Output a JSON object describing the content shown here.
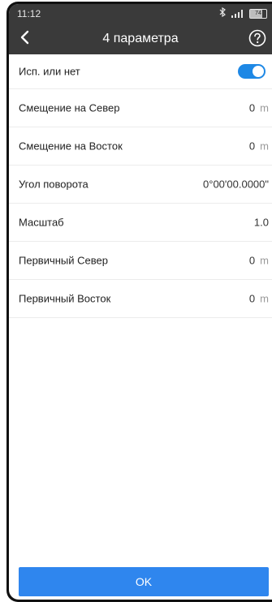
{
  "status_bar": {
    "time": "11:12",
    "battery_percent": "74",
    "battery_level": 0.74,
    "icons": [
      "bluetooth-icon",
      "signal-icon",
      "battery-icon"
    ]
  },
  "header": {
    "title": "4 параметра",
    "back_icon": "chevron-left-icon",
    "help_icon": "question-circle-icon"
  },
  "rows": [
    {
      "label": "Исп. или нет",
      "type": "toggle",
      "checked": true
    },
    {
      "label": "Смещение на Север",
      "value": "0",
      "unit": "m"
    },
    {
      "label": "Смещение на Восток",
      "value": "0",
      "unit": "m"
    },
    {
      "label": "Угол поворота",
      "value": "0°00'00.0000\"",
      "unit": ""
    },
    {
      "label": "Масштаб",
      "value": "1.0",
      "unit": ""
    },
    {
      "label": "Первичный Север",
      "value": "0",
      "unit": "m"
    },
    {
      "label": "Первичный Восток",
      "value": "0",
      "unit": "m"
    }
  ],
  "footer": {
    "ok_label": "OK"
  },
  "colors": {
    "accent": "#2f86ee",
    "header_bg": "#3a3a3a"
  }
}
